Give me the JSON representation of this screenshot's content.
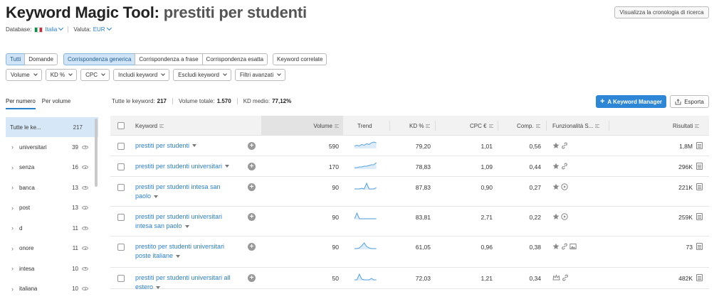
{
  "header": {
    "title": "Keyword Magic Tool:",
    "keyword": "prestiti per studenti",
    "database_label": "Database:",
    "database_value": "Italia",
    "currency_label": "Valuta:",
    "currency_value": "EUR",
    "history_button": "Visualizza la cronologia di ricerca"
  },
  "match_tabs": {
    "group1": [
      "Tutti",
      "Domande"
    ],
    "group2": [
      "Corrispondenza generica",
      "Corrispondenza a frase",
      "Corrispondenza esatta"
    ],
    "related": "Keyword correlate"
  },
  "filters": [
    "Volume",
    "KD %",
    "CPC",
    "Includi keyword",
    "Escludi keyword",
    "Filtri avanzati"
  ],
  "sidebar": {
    "tabs": [
      "Per numero",
      "Per volume"
    ],
    "head": {
      "label": "Tutte le ke...",
      "count": "217"
    },
    "items": [
      {
        "label": "universitari",
        "count": "39"
      },
      {
        "label": "senza",
        "count": "16"
      },
      {
        "label": "banca",
        "count": "13"
      },
      {
        "label": "post",
        "count": "13"
      },
      {
        "label": "d",
        "count": "11"
      },
      {
        "label": "onore",
        "count": "11"
      },
      {
        "label": "intesa",
        "count": "10"
      },
      {
        "label": "italiana",
        "count": "10"
      }
    ]
  },
  "stats": {
    "all_label": "Tutte le keyword:",
    "all_value": "217",
    "volume_label": "Volume totale:",
    "volume_value": "1.570",
    "kd_label": "KD medio:",
    "kd_value": "77,12%"
  },
  "buttons": {
    "keyword_manager": "A Keyword Manager",
    "export": "Esporta"
  },
  "table": {
    "headers": {
      "keyword": "Keyword",
      "volume": "Volume",
      "trend": "Trend",
      "kd": "KD %",
      "cpc": "CPC €",
      "comp": "Comp.",
      "features": "Funzionalità S...",
      "results": "Risultati"
    },
    "rows": [
      {
        "kw1": "prestiti per studenti",
        "kw2": "",
        "volume": "590",
        "kd": "79,20",
        "cpc": "1,01",
        "comp": "0,56",
        "results": "1,8M",
        "features": [
          "star-icon",
          "link-icon"
        ],
        "trend": [
          3,
          4,
          3,
          5,
          4,
          6,
          5,
          7,
          8,
          7
        ]
      },
      {
        "kw1": "prestiti per studenti universitari",
        "kw2": "",
        "volume": "170",
        "kd": "78,83",
        "cpc": "1,09",
        "comp": "0,44",
        "results": "296K",
        "features": [
          "star-icon",
          "link-icon"
        ],
        "trend": [
          2,
          2,
          3,
          3,
          4,
          4,
          5,
          6,
          6,
          9
        ]
      },
      {
        "kw1": "prestiti per studenti intesa san",
        "kw2": "paolo",
        "volume": "90",
        "kd": "87,83",
        "cpc": "0,90",
        "comp": "0,27",
        "results": "221K",
        "features": [
          "star-icon",
          "play-icon"
        ],
        "trend": [
          1,
          1,
          1,
          2,
          1,
          9,
          1,
          1,
          1,
          3
        ]
      },
      {
        "kw1": "prestiti per studenti universitari",
        "kw2": "intesa san paolo",
        "volume": "90",
        "kd": "83,81",
        "cpc": "2,71",
        "comp": "0,22",
        "results": "259K",
        "features": [
          "star-icon",
          "play-icon"
        ],
        "trend": [
          1,
          9,
          1,
          1,
          1,
          1,
          1,
          1,
          1,
          1
        ]
      },
      {
        "kw1": "prestito per studenti universitari",
        "kw2": "poste italiane",
        "volume": "90",
        "kd": "61,05",
        "cpc": "0,96",
        "comp": "0,38",
        "results": "73",
        "features": [
          "star-icon",
          "link-icon",
          "image-icon"
        ],
        "trend": [
          1,
          1,
          2,
          5,
          9,
          4,
          2,
          1,
          1,
          1
        ]
      },
      {
        "kw1": "prestiti per studenti universitari all",
        "kw2": "estero",
        "volume": "50",
        "kd": "72,03",
        "cpc": "1,21",
        "comp": "0,34",
        "results": "482K",
        "features": [
          "crown-icon",
          "link-icon"
        ],
        "trend": [
          1,
          1,
          9,
          2,
          1,
          1,
          1,
          3,
          1,
          1
        ]
      }
    ]
  }
}
